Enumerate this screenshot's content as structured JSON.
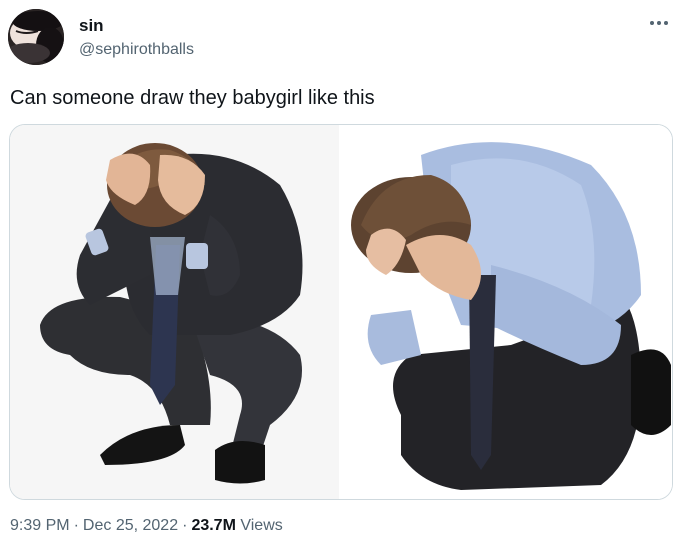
{
  "author": {
    "display_name": "sin",
    "handle": "@sephirothballs"
  },
  "tweet": {
    "text": "Can someone draw they babygirl like this"
  },
  "media": {
    "photos": [
      {
        "subject": "man in dark suit squatting, hands clutching head"
      },
      {
        "subject": "man in light blue shirt kneeling, hands clutching head"
      }
    ]
  },
  "meta": {
    "time": "9:39 PM",
    "separator": "·",
    "date": "Dec 25, 2022",
    "views_count": "23.7M",
    "views_label": "Views"
  },
  "colors": {
    "text_primary": "#0f1419",
    "text_secondary": "#536471",
    "border": "#cfd9de"
  },
  "icons": {
    "more": "more-horizontal-icon"
  }
}
